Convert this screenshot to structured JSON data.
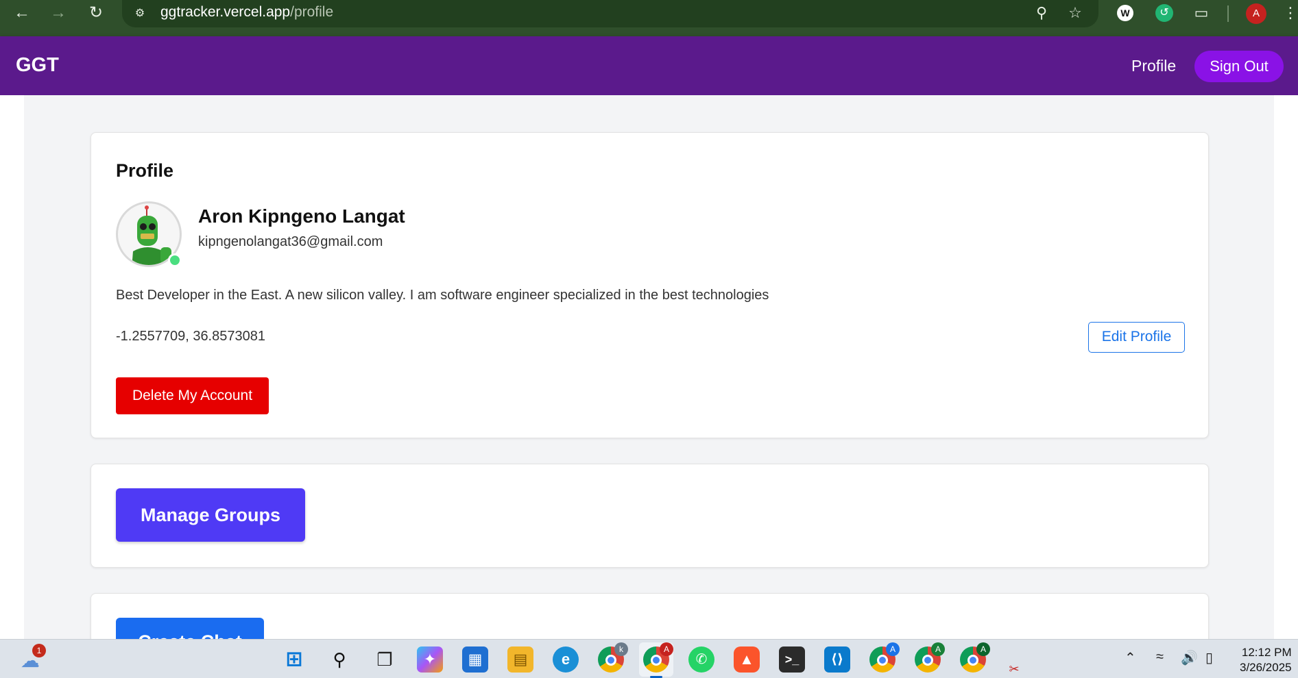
{
  "browser": {
    "url_domain": "ggtracker.vercel.app",
    "url_path": "/profile",
    "profile_initial": "A"
  },
  "header": {
    "brand": "GGT",
    "nav_profile": "Profile",
    "sign_out": "Sign Out"
  },
  "profile_card": {
    "title": "Profile",
    "name": "Aron Kipngeno Langat",
    "email": "kipngenolangat36@gmail.com",
    "bio": "Best Developer in the East. A new silicon valley. I am software engineer specialized in the best technologies",
    "coordinates": "-1.2557709, 36.8573081",
    "edit_label": "Edit Profile",
    "delete_label": "Delete My Account"
  },
  "groups_card": {
    "manage_label": "Manage Groups"
  },
  "chat_card": {
    "button_label": "Create Chat"
  },
  "taskbar": {
    "weather_badge": "1",
    "chrome_badge_k": "k",
    "chrome_badge_a": "A",
    "time": "12:12 PM",
    "date": "3/26/2025"
  },
  "colors": {
    "chrome_bg": "#2f4f2b",
    "appbar": "#5b1a8c",
    "signout": "#8a12e6",
    "delete": "#e60000",
    "manage": "#4f3af5",
    "edit": "#1a73e8"
  }
}
